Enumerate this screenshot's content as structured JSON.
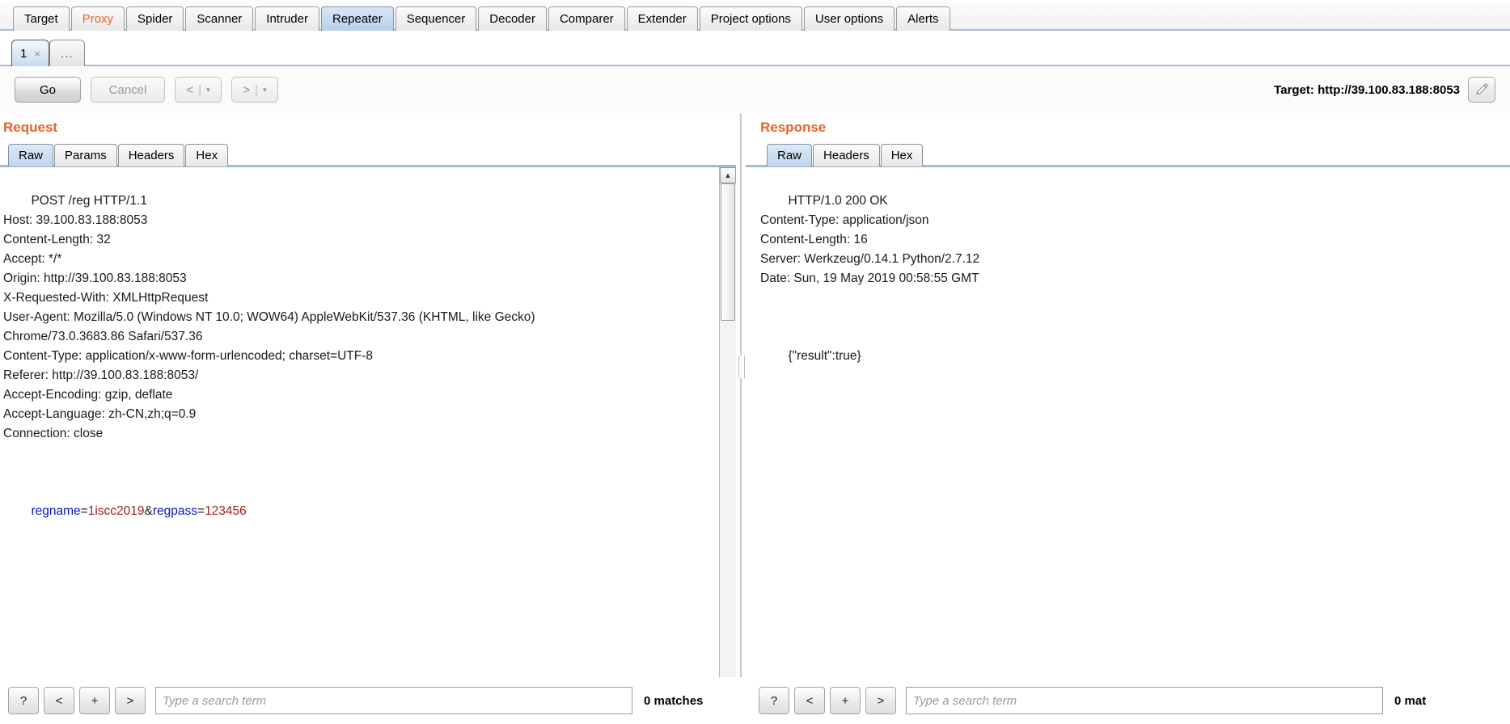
{
  "app": {
    "main_tabs": [
      {
        "label": "Target",
        "state": "normal"
      },
      {
        "label": "Proxy",
        "state": "alert"
      },
      {
        "label": "Spider",
        "state": "normal"
      },
      {
        "label": "Scanner",
        "state": "normal"
      },
      {
        "label": "Intruder",
        "state": "normal"
      },
      {
        "label": "Repeater",
        "state": "selected"
      },
      {
        "label": "Sequencer",
        "state": "normal"
      },
      {
        "label": "Decoder",
        "state": "normal"
      },
      {
        "label": "Comparer",
        "state": "normal"
      },
      {
        "label": "Extender",
        "state": "normal"
      },
      {
        "label": "Project options",
        "state": "normal"
      },
      {
        "label": "User options",
        "state": "normal"
      },
      {
        "label": "Alerts",
        "state": "normal"
      }
    ]
  },
  "repeater": {
    "tabs": [
      {
        "label": "1",
        "close": "×",
        "state": "selected"
      },
      {
        "label": "...",
        "state": "inactive"
      }
    ],
    "toolbar": {
      "go_label": "Go",
      "cancel_label": "Cancel",
      "prev_label": "<",
      "next_label": ">",
      "caret": "▾",
      "divider": "|",
      "target_text": "Target: http://39.100.83.188:8053",
      "edit_icon_name": "pencil-icon"
    }
  },
  "request": {
    "title": "Request",
    "tabs": [
      {
        "label": "Raw",
        "state": "selected"
      },
      {
        "label": "Params",
        "state": "normal"
      },
      {
        "label": "Headers",
        "state": "normal"
      },
      {
        "label": "Hex",
        "state": "normal"
      }
    ],
    "headers_text": "POST /reg HTTP/1.1\nHost: 39.100.83.188:8053\nContent-Length: 32\nAccept: */*\nOrigin: http://39.100.83.188:8053\nX-Requested-With: XMLHttpRequest\nUser-Agent: Mozilla/5.0 (Windows NT 10.0; WOW64) AppleWebKit/537.36 (KHTML, like Gecko)\nChrome/73.0.3683.86 Safari/537.36\nContent-Type: application/x-www-form-urlencoded; charset=UTF-8\nReferer: http://39.100.83.188:8053/\nAccept-Encoding: gzip, deflate\nAccept-Language: zh-CN,zh;q=0.9\nConnection: close",
    "body": {
      "param1_name": "regname",
      "param1_eq": "=",
      "param1_value": "1iscc2019",
      "amp": "&",
      "param2_name": "regpass",
      "param2_eq": "=",
      "param2_value": "123456"
    },
    "search": {
      "help_label": "?",
      "prev_label": "<",
      "add_label": "+",
      "next_label": ">",
      "placeholder": "Type a search term",
      "matches_label": "0 matches"
    }
  },
  "response": {
    "title": "Response",
    "tabs": [
      {
        "label": "Raw",
        "state": "selected"
      },
      {
        "label": "Headers",
        "state": "normal"
      },
      {
        "label": "Hex",
        "state": "normal"
      }
    ],
    "headers_text": "HTTP/1.0 200 OK\nContent-Type: application/json\nContent-Length: 16\nServer: Werkzeug/0.14.1 Python/2.7.12\nDate: Sun, 19 May 2019 00:58:55 GMT",
    "body_text": "{\"result\":true}",
    "search": {
      "help_label": "?",
      "prev_label": "<",
      "add_label": "+",
      "next_label": ">",
      "placeholder": "Type a search term",
      "matches_label": "0 mat"
    }
  },
  "colors": {
    "accent": "#e8642a",
    "selected_tab": "#bfd4ec",
    "param_key": "#1010cc",
    "param_value": "#9b1c1c"
  }
}
